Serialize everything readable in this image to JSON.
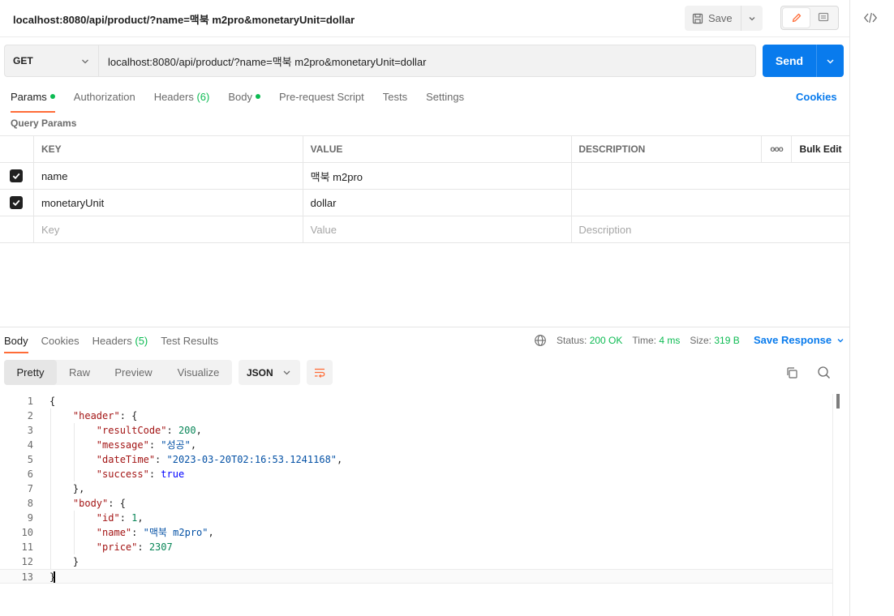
{
  "title_bar": {
    "title": "localhost:8080/api/product/?name=맥북 m2pro&monetaryUnit=dollar",
    "save_label": "Save"
  },
  "request": {
    "method": "GET",
    "url": "localhost:8080/api/product/?name=맥북 m2pro&monetaryUnit=dollar",
    "send_label": "Send"
  },
  "request_tabs": [
    {
      "label": "Params",
      "active": true,
      "dot": true
    },
    {
      "label": "Authorization"
    },
    {
      "label": "Headers",
      "count": "(6)"
    },
    {
      "label": "Body",
      "dot": true
    },
    {
      "label": "Pre-request Script"
    },
    {
      "label": "Tests"
    },
    {
      "label": "Settings"
    }
  ],
  "cookies_label": "Cookies",
  "query_params_label": "Query Params",
  "params_table": {
    "headers": {
      "key": "KEY",
      "value": "VALUE",
      "description": "DESCRIPTION",
      "more": "ooo",
      "bulk_edit": "Bulk Edit"
    },
    "rows": [
      {
        "checked": true,
        "key": "name",
        "value": "맥북 m2pro",
        "description": ""
      },
      {
        "checked": true,
        "key": "monetaryUnit",
        "value": "dollar",
        "description": ""
      }
    ],
    "placeholders": {
      "key": "Key",
      "value": "Value",
      "description": "Description"
    }
  },
  "response_tabs": [
    {
      "label": "Body",
      "active": true
    },
    {
      "label": "Cookies"
    },
    {
      "label": "Headers",
      "count": "(5)"
    },
    {
      "label": "Test Results"
    }
  ],
  "status": {
    "status_label": "Status:",
    "status_value": "200 OK",
    "time_label": "Time:",
    "time_value": "4 ms",
    "size_label": "Size:",
    "size_value": "319 B",
    "save_response_label": "Save Response"
  },
  "view_modes": [
    {
      "label": "Pretty",
      "active": true
    },
    {
      "label": "Raw"
    },
    {
      "label": "Preview"
    },
    {
      "label": "Visualize"
    }
  ],
  "format": "JSON",
  "code_lines": [
    "{",
    "    \"header\": {",
    "        \"resultCode\": 200,",
    "        \"message\": \"성공\",",
    "        \"dateTime\": \"2023-03-20T02:16:53.1241168\",",
    "        \"success\": true",
    "    },",
    "    \"body\": {",
    "        \"id\": 1,",
    "        \"name\": \"맥북 m2pro\",",
    "        \"price\": 2307",
    "    }",
    "}"
  ],
  "colors": {
    "accent": "#ff6c37",
    "send": "#097bed",
    "success": "#0cbb52",
    "link": "#097bed"
  }
}
